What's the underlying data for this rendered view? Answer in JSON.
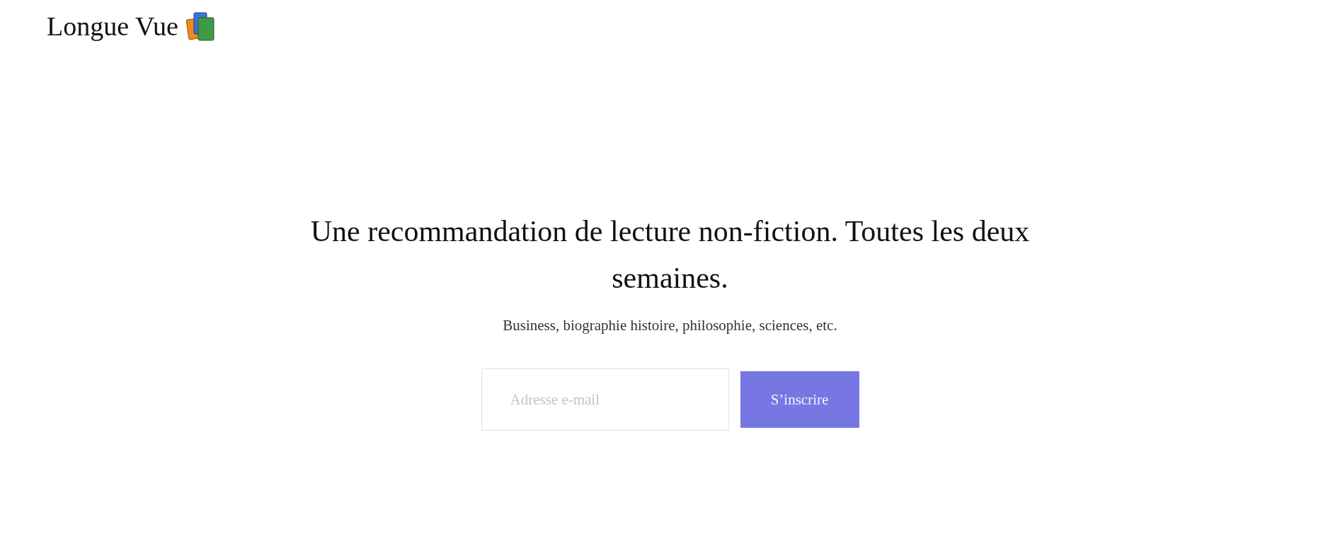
{
  "header": {
    "logo": "Longue Vue"
  },
  "hero": {
    "title": "Une recommandation de lecture non-fiction. Toutes les deux semaines.",
    "subtitle": "Business, biographie histoire, philosophie, sciences, etc."
  },
  "signup": {
    "email_placeholder": "Adresse e-mail",
    "button": "S’inscrire"
  }
}
